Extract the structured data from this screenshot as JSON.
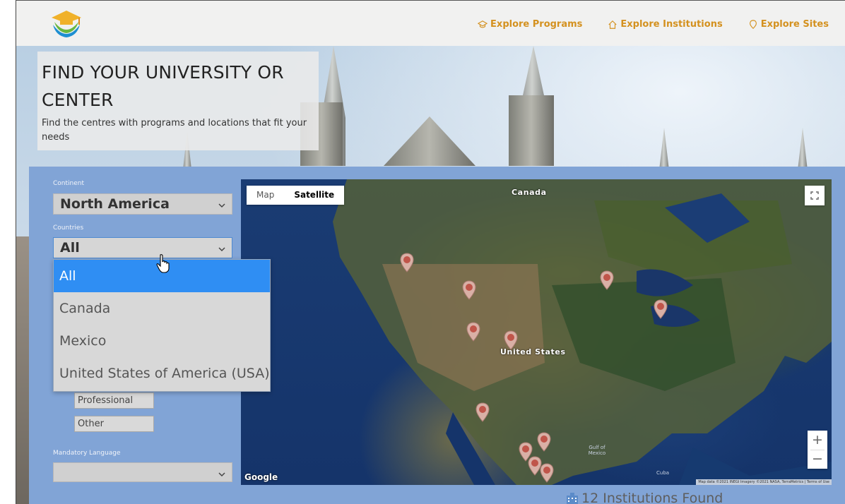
{
  "nav": {
    "programs": "Explore Programs",
    "institutions": "Explore Institutions",
    "sites": "Explore Sites"
  },
  "hero": {
    "title": "FIND YOUR UNIVERSITY OR CENTER",
    "subtitle": "Find the centres with programs and locations that fit your needs"
  },
  "filters": {
    "continent_label": "Continent",
    "continent_value": "North America",
    "countries_label": "Countries",
    "countries_value": "All",
    "country_options": [
      "All",
      "Canada",
      "Mexico",
      "United States of America (USA)"
    ],
    "program_types": [
      "Professional",
      "Other"
    ],
    "language_label": "Mandatory Language",
    "language_value": ""
  },
  "map": {
    "type_map": "Map",
    "type_satellite": "Satellite",
    "label_canada": "Canada",
    "label_us": "United States",
    "label_gulf": "Gulf of Mexico",
    "label_cuba": "Cuba",
    "zoom_in": "+",
    "zoom_out": "−",
    "google": "Google",
    "attribution": "Map data ©2021 INEGI Imagery ©2021 NASA, TerraMetrics | Terms of Use"
  },
  "results": {
    "count_text": "12 Institutions Found"
  },
  "colors": {
    "accent": "#d4911f",
    "panel": "#81a4d6",
    "selected": "#2f8ef3"
  }
}
